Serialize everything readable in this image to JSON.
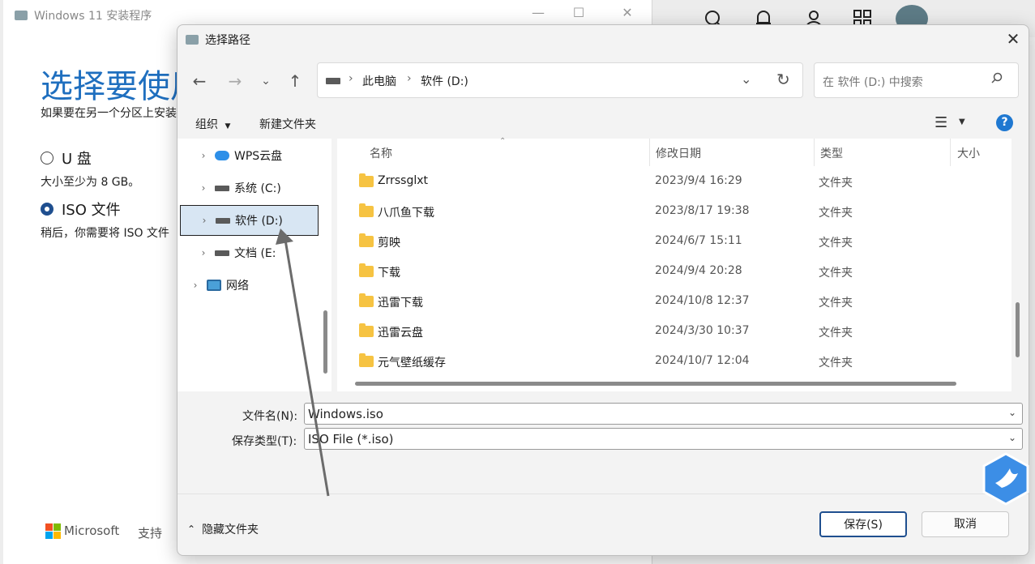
{
  "browser_toolbar": {
    "icons": [
      "search-icon",
      "bell-icon",
      "user-icon",
      "apps-icon",
      "avatar"
    ]
  },
  "installer": {
    "title": "Windows 11 安装程序",
    "heading": "选择要使用",
    "subtitle": "如果要在另一个分区上安装",
    "option_usb_label": "U 盘",
    "option_usb_desc": "大小至少为 8 GB。",
    "option_iso_label": "ISO 文件",
    "option_iso_desc": "稍后，你需要将 ISO 文件",
    "footer_brand": "Microsoft",
    "footer_support": "支持",
    "selected_option": "ISO 文件"
  },
  "dialog": {
    "title": "选择路径",
    "breadcrumb": [
      "此电脑",
      "软件 (D:)"
    ],
    "search_placeholder": "在 软件 (D:) 中搜索",
    "toolbar": {
      "organize": "组织",
      "new_folder": "新建文件夹"
    },
    "nav_items": [
      {
        "label": "WPS云盘",
        "icon": "cloud-icon"
      },
      {
        "label": "系统 (C:)",
        "icon": "drive-icon"
      },
      {
        "label": "软件 (D:)",
        "icon": "drive-icon",
        "selected": true
      },
      {
        "label": "文档 (E:",
        "icon": "drive-icon"
      },
      {
        "label": "网络",
        "icon": "network-icon"
      }
    ],
    "columns": {
      "name": "名称",
      "date": "修改日期",
      "type": "类型",
      "size": "大小"
    },
    "files": [
      {
        "name": "Zrrssglxt",
        "date": "2023/9/4 16:29",
        "type": "文件夹"
      },
      {
        "name": "八爪鱼下载",
        "date": "2023/8/17 19:38",
        "type": "文件夹"
      },
      {
        "name": "剪映",
        "date": "2024/6/7 15:11",
        "type": "文件夹"
      },
      {
        "name": "下载",
        "date": "2024/9/4 20:28",
        "type": "文件夹"
      },
      {
        "name": "迅雷下载",
        "date": "2024/10/8 12:37",
        "type": "文件夹"
      },
      {
        "name": "迅雷云盘",
        "date": "2024/3/30 10:37",
        "type": "文件夹"
      },
      {
        "name": "元气壁纸缓存",
        "date": "2024/10/7 12:04",
        "type": "文件夹"
      }
    ],
    "filename_label": "文件名(N):",
    "filename_value": "Windows.iso",
    "filetype_label": "保存类型(T):",
    "filetype_value": "ISO File (*.iso)",
    "hide_folders": "隐藏文件夹",
    "save_button": "保存(S)",
    "cancel_button": "取消"
  },
  "colors": {
    "accent": "#1f6fbf",
    "selection": "#d8e6f3",
    "folder": "#f6c342",
    "help": "#1f78d1"
  }
}
